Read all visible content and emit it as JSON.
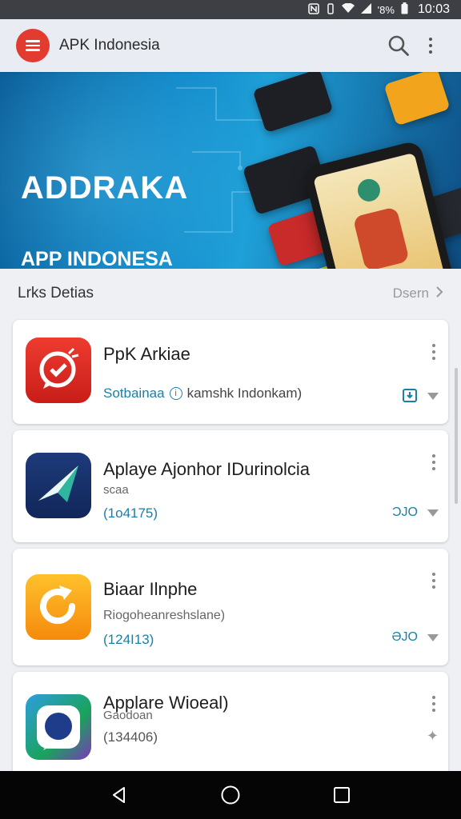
{
  "status_bar": {
    "signal_text": "'8%",
    "time": "10:03"
  },
  "app_bar": {
    "title": "APK Indonesia"
  },
  "banner": {
    "title": "ADDRAKA",
    "subtitle": "APP INDONESA"
  },
  "section": {
    "title": "Lrks Detias",
    "link": "Dsern"
  },
  "apps": [
    {
      "name": "PpK Arkiae",
      "sub": "",
      "meta_left": "Sotbainaa",
      "meta_right": "kamshk Indonkam)",
      "tag": ""
    },
    {
      "name": "Aplaye Ajonhor IDurinolcia",
      "sub": "scaa",
      "meta_left": "(1o4175)",
      "meta_right": "",
      "tag": "ƆJO"
    },
    {
      "name": "Biaar Ilnphe",
      "sub": "Riogoheanreshslane)",
      "meta_left": "(124I13)",
      "meta_right": "",
      "tag": "ƏJO"
    },
    {
      "name": "Applare Wioeal)",
      "sub": "Gaodoan",
      "meta_left": "(134406)",
      "meta_right": "",
      "tag": ""
    }
  ],
  "colors": {
    "accent": "#e23b2f",
    "link": "#1b7fa8",
    "banner": "#1289c9"
  },
  "icons": {
    "menu": "hamburger-icon",
    "search": "search-icon",
    "more": "more-vert-icon",
    "back": "back-icon",
    "home": "home-icon",
    "recents": "recents-icon"
  }
}
